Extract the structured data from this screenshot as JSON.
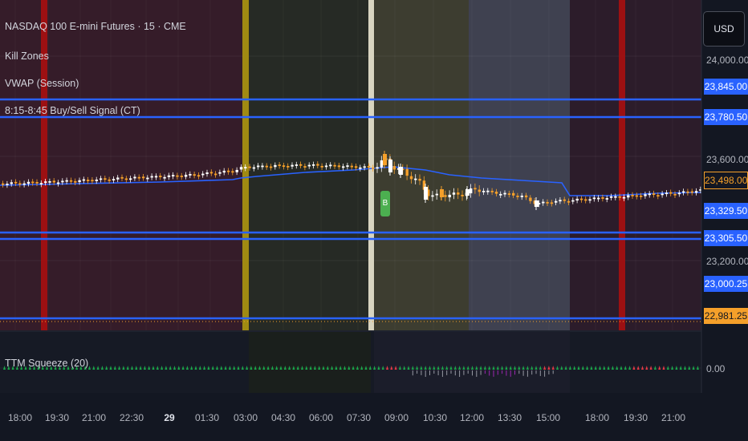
{
  "chart_header": {
    "symbol_title": "NASDAQ 100 E-mini Futures · 15 · CME",
    "indicators": [
      "Kill Zones",
      "VWAP (Session)",
      "8:15-8:45 Buy/Sell Signal (CT)"
    ]
  },
  "currency_button": "USD",
  "price_axis": {
    "ticks": [
      "24,000.00",
      "23,600.00",
      "23,200.00"
    ],
    "labels": [
      {
        "text": "23,845.00",
        "kind": "level"
      },
      {
        "text": "23,780.50",
        "kind": "level"
      },
      {
        "text": "23,498.00",
        "kind": "current"
      },
      {
        "text": "23,329.50",
        "kind": "level"
      },
      {
        "text": "23,305.50",
        "kind": "level"
      },
      {
        "text": "23,000.25",
        "kind": "level"
      },
      {
        "text": "22,981.25",
        "kind": "last"
      }
    ]
  },
  "signal_marker": "B",
  "squeeze_panel": {
    "title": "TTM Squeeze (20)",
    "zero_value": "0.00"
  },
  "time_axis": {
    "labels": [
      "18:00",
      "19:30",
      "21:00",
      "22:30",
      "29",
      "01:30",
      "03:00",
      "04:30",
      "06:00",
      "07:30",
      "09:00",
      "10:30",
      "12:00",
      "13:30",
      "15:00",
      "18:00",
      "19:30",
      "21:00"
    ]
  },
  "colors": {
    "background": "#131722",
    "level_line": "#2962ff",
    "vwap": "#2962ff",
    "up_candle": "#ffffff",
    "down_candle": "#f5a02a",
    "killzone_red": "#a81010",
    "killzone_gold": "#a08a12",
    "signal_green": "#4caf50"
  }
}
